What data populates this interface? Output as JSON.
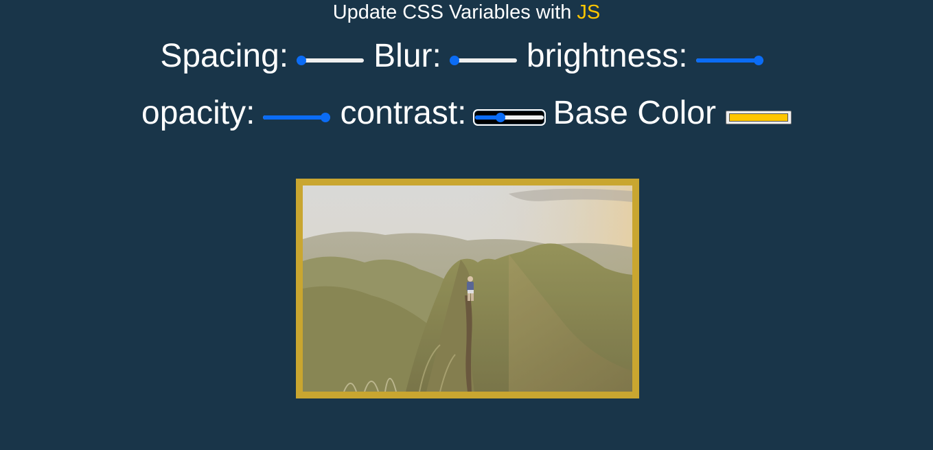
{
  "header": {
    "title_prefix": "Update CSS Variables with ",
    "title_highlight": "JS",
    "highlight_color": "#ffc600"
  },
  "controls": {
    "spacing": {
      "label": "Spacing:",
      "value": 0,
      "min": 0,
      "max": 1
    },
    "blur": {
      "label": "Blur:",
      "value": 0,
      "min": 0,
      "max": 1
    },
    "brightness": {
      "label": "brightness:",
      "value": 1,
      "min": 0,
      "max": 1
    },
    "opacity": {
      "label": "opacity:",
      "value": 1,
      "min": 0,
      "max": 1
    },
    "contrast": {
      "label": "contrast:",
      "value": 0.35,
      "min": 0,
      "max": 1
    },
    "base_color": {
      "label": "Base Color",
      "value": "#ffc600"
    }
  },
  "image": {
    "frame_color": "#c9a630",
    "description_icon": "mountain-hiker-photo"
  },
  "colors": {
    "background": "#193549",
    "slider_accent": "#0b6cf5",
    "track": "#efefef"
  }
}
